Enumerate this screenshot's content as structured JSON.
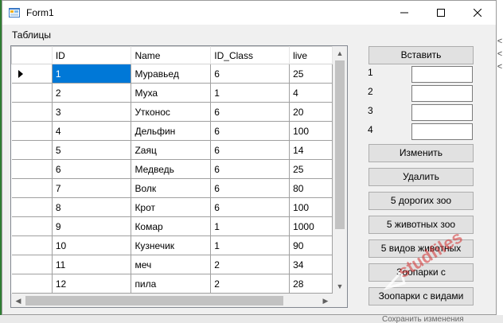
{
  "window": {
    "title": "Form1"
  },
  "menu": {
    "tables": "Таблицы"
  },
  "grid": {
    "columns": [
      "ID",
      "Name",
      "ID_Class",
      "live"
    ],
    "rows": [
      [
        "1",
        "Муравьед",
        "6",
        "25"
      ],
      [
        "2",
        "Муха",
        "1",
        "4"
      ],
      [
        "3",
        "Утконос",
        "6",
        "20"
      ],
      [
        "4",
        "Дельфин",
        "6",
        "100"
      ],
      [
        "5",
        "Zаяц",
        "6",
        "14"
      ],
      [
        "6",
        "Медведь",
        "6",
        "25"
      ],
      [
        "7",
        "Волк",
        "6",
        "80"
      ],
      [
        "8",
        "Крот",
        "6",
        "100"
      ],
      [
        "9",
        "Комар",
        "1",
        "1000"
      ],
      [
        "10",
        "Кузнечик",
        "1",
        "90"
      ],
      [
        "11",
        "меч",
        "2",
        "34"
      ],
      [
        "12",
        "пила",
        "2",
        "28"
      ]
    ],
    "selected_row": 0
  },
  "panel": {
    "insert_button": "Вставить",
    "field_labels": [
      "1",
      "2",
      "3",
      "4"
    ],
    "field_values": [
      "",
      "",
      "",
      ""
    ],
    "change_button": "Изменить",
    "delete_button": "Удалить",
    "expensive_zoo_button": "5 дорогих зоо",
    "animals_zoo_button": "5 животных зоо",
    "species_button": "5 видов животных",
    "zoos_with_button": "Зоопарки с",
    "zoos_with_species_button": "Зоопарки с видами"
  },
  "watermark": {
    "text": "studfiles"
  },
  "background": {
    "bottom_text": "Сохранить изменения",
    "right_symbols": [
      "<",
      "<",
      "<"
    ]
  },
  "colors": {
    "selection": "#0078d7",
    "button_face": "#e1e1e1",
    "watermark": "#d32f2f"
  }
}
